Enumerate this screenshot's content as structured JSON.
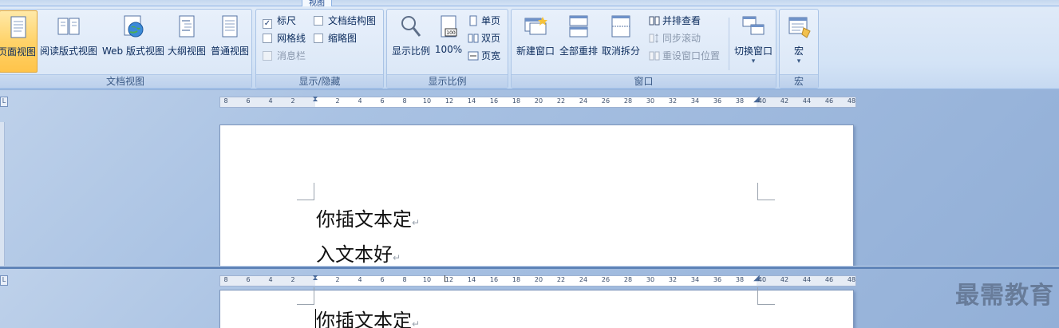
{
  "ribbon": {
    "active_tab": "视图",
    "groups": {
      "doc_views": {
        "label": "文档视图",
        "buttons": [
          "页面视图",
          "阅读版式视图",
          "Web 版式视图",
          "大纲视图",
          "普通视图"
        ]
      },
      "show_hide": {
        "label": "显示/隐藏",
        "items": [
          {
            "label": "标尺",
            "checked": true,
            "disabled": false
          },
          {
            "label": "文档结构图",
            "checked": false,
            "disabled": false
          },
          {
            "label": "网格线",
            "checked": false,
            "disabled": false
          },
          {
            "label": "缩略图",
            "checked": false,
            "disabled": false
          },
          {
            "label": "消息栏",
            "checked": false,
            "disabled": true
          }
        ]
      },
      "zoom": {
        "label": "显示比例",
        "zoom_button": "显示比例",
        "hundred_button": "100%",
        "single_page": "单页",
        "two_pages": "双页",
        "page_width": "页宽"
      },
      "window": {
        "label": "窗口",
        "new_window": "新建窗口",
        "arrange_all": "全部重排",
        "remove_split": "取消拆分",
        "view_side_by_side": "并排查看",
        "sync_scroll": "同步滚动",
        "reset_position": "重设窗口位置",
        "switch_windows": "切换窗口",
        "dropdown_arrow": "▾"
      },
      "macros": {
        "label": "宏",
        "button": "宏",
        "dropdown_arrow": "▾"
      }
    }
  },
  "ruler": {
    "left_ticks": [
      "8",
      "6",
      "4",
      "2"
    ],
    "right_ticks": [
      "2",
      "4",
      "6",
      "8",
      "10",
      "12",
      "14",
      "16",
      "18",
      "20",
      "22",
      "24",
      "26",
      "28",
      "30",
      "32",
      "34",
      "36",
      "38",
      "40",
      "42",
      "44",
      "46",
      "48"
    ],
    "corner_glyph": "L"
  },
  "document": {
    "pane1_lines": [
      "你插文本定",
      "入文本好"
    ],
    "pane2_lines": [
      "你插文本定"
    ],
    "paragraph_mark": "↵"
  },
  "watermark": "最需教育"
}
